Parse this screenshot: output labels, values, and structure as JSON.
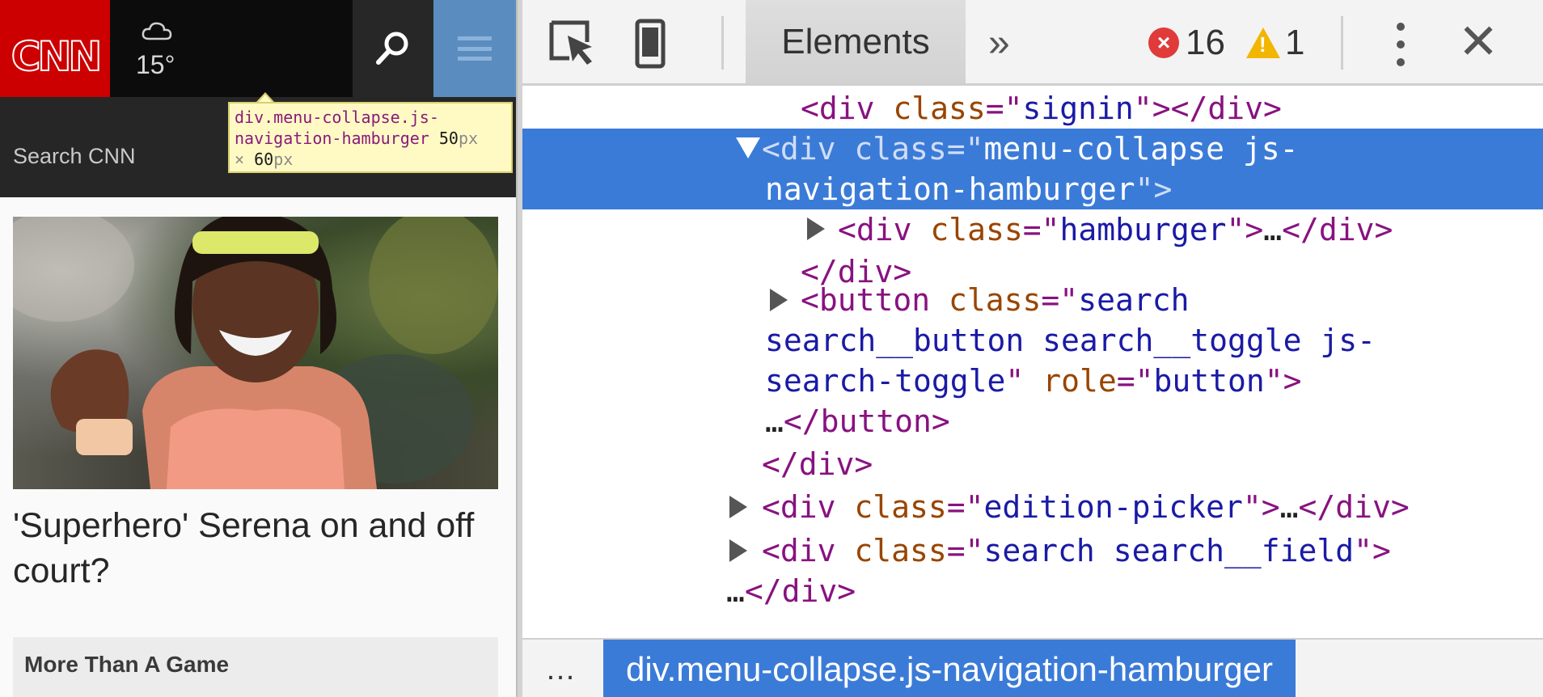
{
  "page": {
    "logo_text": "CNN",
    "weather_temp": "15°",
    "search_placeholder": "Search CNN",
    "headline": "'Superhero' Serena on and off court?",
    "section_label": "More Than A Game",
    "tooltip": {
      "selector": "div.menu-collapse.js-navigation-hamburger",
      "width": "50",
      "height": "60",
      "unit": "px",
      "times": "×"
    }
  },
  "devtools": {
    "tab_label": "Elements",
    "more_tabs": "»",
    "error_count": "16",
    "warning_count": "1",
    "close_label": "✕",
    "dom_lines": {
      "l1": {
        "open": "<div ",
        "attr": "class",
        "eq": "=\"",
        "val": "signin",
        "close": "\"></div>"
      },
      "l2a": {
        "open": "<div ",
        "attr": "class",
        "eq": "=\"",
        "val": "menu-collapse js-"
      },
      "l2b": {
        "val": "navigation-hamburger",
        "close": "\">"
      },
      "l3": {
        "open": "<div ",
        "attr": "class",
        "eq": "=\"",
        "val": "hamburger",
        "mid": "\">",
        "ellipsis": "…",
        "close": "</div>"
      },
      "l4": {
        "close": "</div>"
      },
      "l5a": {
        "open": "<button ",
        "attr": "class",
        "eq": "=\"",
        "val": "search"
      },
      "l5b": {
        "val": "search__button search__toggle js-"
      },
      "l5c": {
        "val": "search-toggle",
        "q": "\" ",
        "attr": "role",
        "eq": "=\"",
        "val2": "button",
        "close": "\">"
      },
      "l5d": {
        "ellipsis": "…",
        "close": "</button>"
      },
      "l6": {
        "close": "</div>"
      },
      "l7": {
        "open": "<div ",
        "attr": "class",
        "eq": "=\"",
        "val": "edition-picker",
        "mid": "\">",
        "ellipsis": "…",
        "close": "</div>"
      },
      "l8a": {
        "open": "<div ",
        "attr": "class",
        "eq": "=\"",
        "val": "search search__field",
        "close": "\">"
      },
      "l8b": {
        "ellipsis": "…",
        "close": "</div>"
      }
    },
    "breadcrumb": {
      "more": "…",
      "selected": "div.menu-collapse.js-navigation-hamburger"
    }
  },
  "colors": {
    "cnn_red": "#cc0000",
    "selection_blue": "#3b7bd8",
    "tag_purple": "#881280",
    "attr_brown": "#994500",
    "value_blue": "#1a1aa6",
    "error_red": "#e03a3a",
    "warning_yellow": "#f2b500"
  },
  "icons": [
    "cloud-icon",
    "search-icon",
    "hamburger-icon",
    "inspect-element-icon",
    "device-mode-icon",
    "error-icon",
    "warning-icon",
    "kebab-menu-icon",
    "close-icon"
  ]
}
